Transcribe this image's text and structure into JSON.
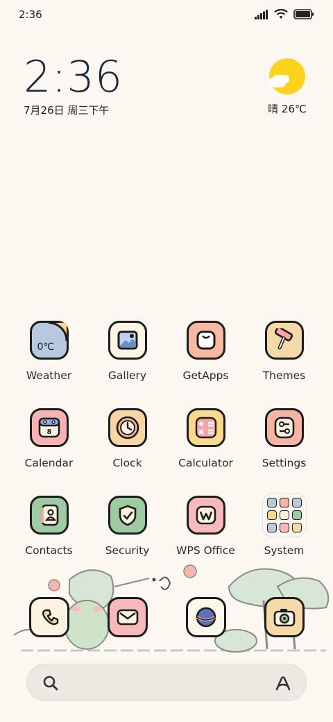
{
  "status_bar": {
    "time": "2:36"
  },
  "clock_widget": {
    "time": "2:36",
    "date": "7月26日 周三下午"
  },
  "weather_widget": {
    "text": "晴 26℃"
  },
  "apps": [
    {
      "label": "Weather",
      "icon": "weather-icon",
      "color": "#b8c9dd",
      "inner": "0℃"
    },
    {
      "label": "Gallery",
      "icon": "gallery-icon",
      "color": "#fdf6e6"
    },
    {
      "label": "GetApps",
      "icon": "getapps-icon",
      "color": "#f8b9a3"
    },
    {
      "label": "Themes",
      "icon": "themes-icon",
      "color": "#f6d9a8"
    },
    {
      "label": "Calendar",
      "icon": "calendar-icon",
      "color": "#f5b3b4"
    },
    {
      "label": "Clock",
      "icon": "clock-icon",
      "color": "#f6d7a3"
    },
    {
      "label": "Calculator",
      "icon": "calculator-icon",
      "color": "#fbd98c"
    },
    {
      "label": "Settings",
      "icon": "settings-icon",
      "color": "#f7b4a3"
    },
    {
      "label": "Contacts",
      "icon": "contacts-icon",
      "color": "#9fcba3"
    },
    {
      "label": "Security",
      "icon": "security-icon",
      "color": "#9fcba3"
    },
    {
      "label": "WPS Office",
      "icon": "wps-office-icon",
      "color": "#f7b9b9"
    },
    {
      "label": "System",
      "icon": "system-folder-icon",
      "color": "#fbf8f4"
    }
  ],
  "dock": [
    {
      "icon": "phone-icon",
      "color": "#fdf3e3"
    },
    {
      "icon": "messages-icon",
      "color": "#f7b9b9"
    },
    {
      "icon": "browser-icon",
      "color": "#fdf6ea"
    },
    {
      "icon": "camera-icon",
      "color": "#f6d9a8"
    }
  ]
}
